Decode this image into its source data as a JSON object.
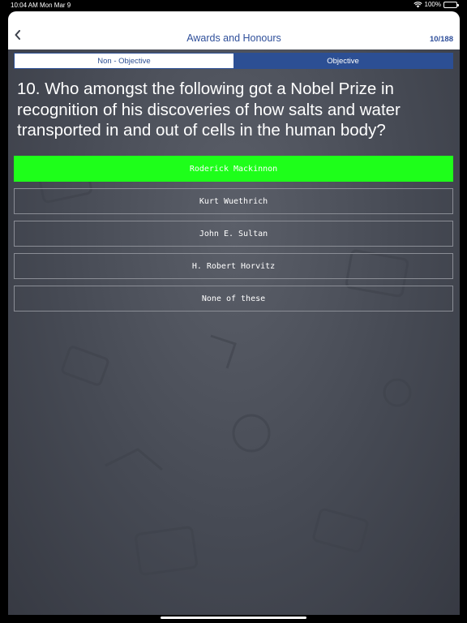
{
  "status_bar": {
    "time": "10:04 AM",
    "date": "Mon Mar 9",
    "battery": "100%"
  },
  "nav": {
    "back_icon": "chevron-left-icon",
    "title": "Awards and Honours",
    "counter": "10/188"
  },
  "tabs": [
    {
      "label": "Non - Objective",
      "active": false
    },
    {
      "label": "Objective",
      "active": true
    }
  ],
  "question": {
    "text": "10. Who amongst the following got a Nobel Prize in recognition of his discoveries of how salts and water transported in and out of cells in the human body?"
  },
  "options": [
    {
      "label": "Roderick Mackinnon",
      "state": "correct"
    },
    {
      "label": "Kurt Wuethrich",
      "state": "default"
    },
    {
      "label": "John E. Sultan",
      "state": "default"
    },
    {
      "label": "H. Robert Horvitz",
      "state": "default"
    },
    {
      "label": "None of these",
      "state": "default"
    }
  ],
  "colors": {
    "accent": "#2c4f94",
    "correct": "#1eff1a",
    "background": "#464a54"
  }
}
